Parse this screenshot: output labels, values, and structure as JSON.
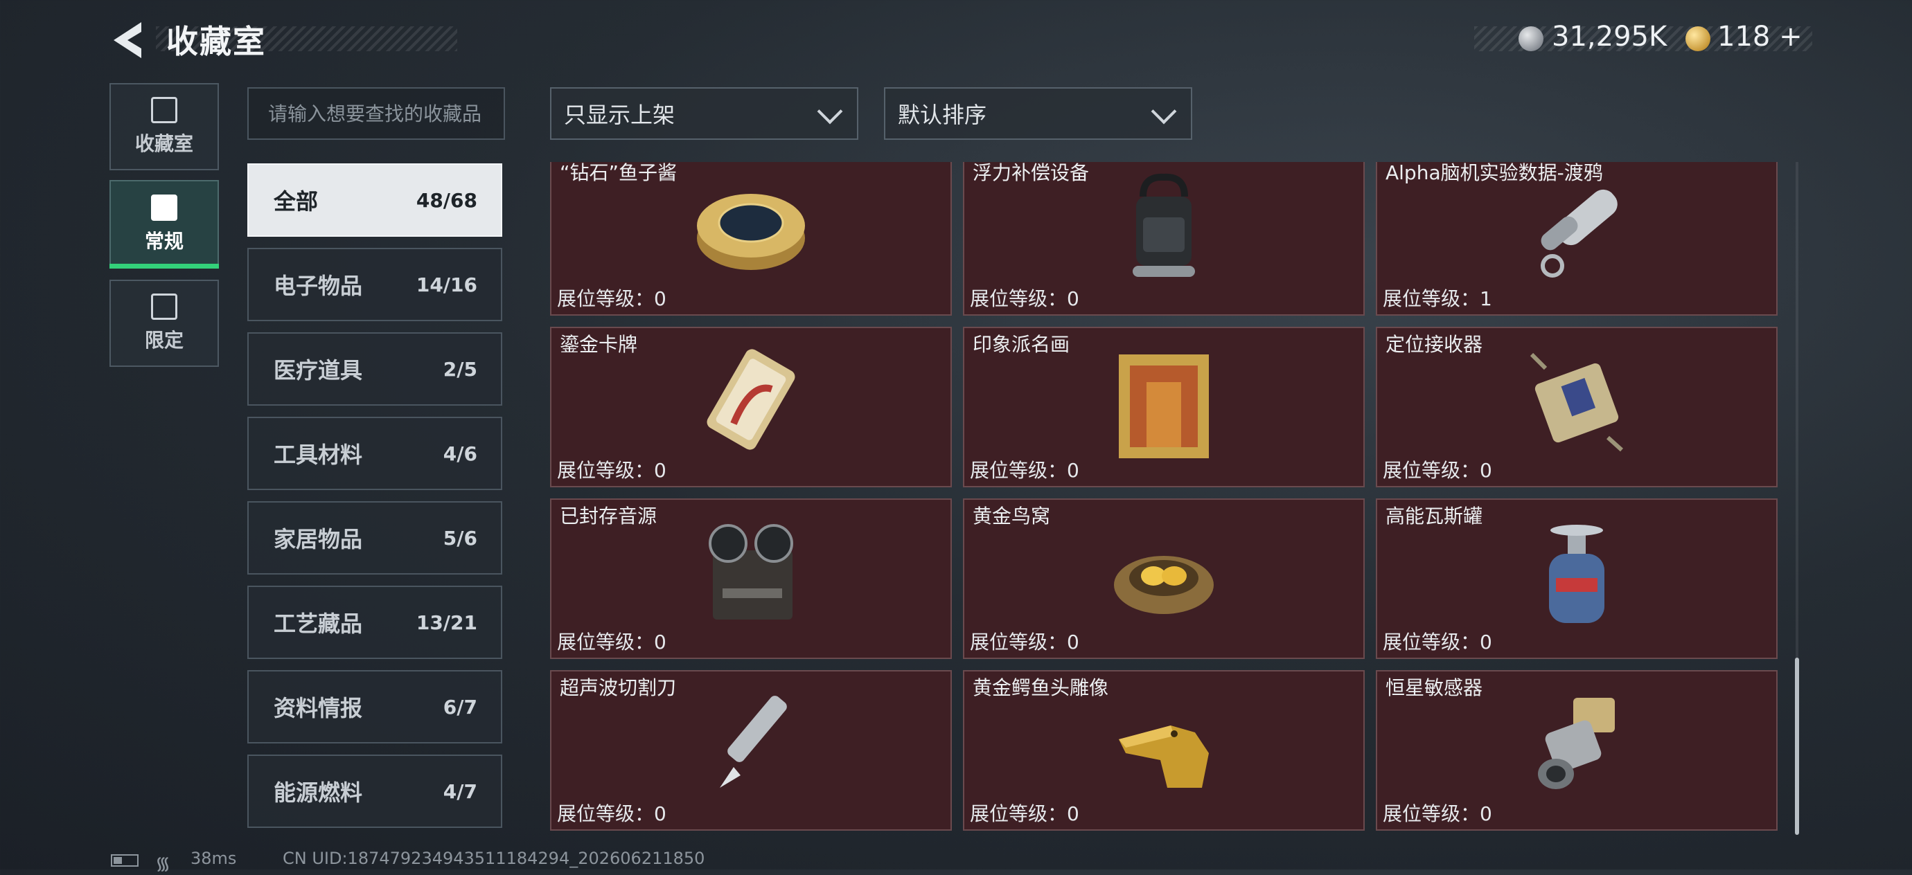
{
  "header": {
    "title": "收藏室",
    "currency": [
      {
        "icon": "silver-coin-icon",
        "value": "31,295K"
      },
      {
        "icon": "gold-triangle-coin-icon",
        "value": "118 +"
      }
    ]
  },
  "nav_tabs": [
    {
      "label": "收藏室",
      "icon": "collection-room-icon",
      "active": false
    },
    {
      "label": "常规",
      "icon": "regular-tab-icon",
      "active": true
    },
    {
      "label": "限定",
      "icon": "limited-tab-icon",
      "active": false
    }
  ],
  "search": {
    "placeholder": "请输入想要查找的收藏品"
  },
  "filters": {
    "listing_filter": "只显示上架",
    "sort": "默认排序"
  },
  "categories": [
    {
      "label": "全部",
      "count": "48/68",
      "active": true
    },
    {
      "label": "电子物品",
      "count": "14/16"
    },
    {
      "label": "医疗道具",
      "count": "2/5"
    },
    {
      "label": "工具材料",
      "count": "4/6"
    },
    {
      "label": "家居物品",
      "count": "5/6"
    },
    {
      "label": "工艺藏品",
      "count": "13/21"
    },
    {
      "label": "资料情报",
      "count": "6/7"
    },
    {
      "label": "能源燃料",
      "count": "4/7"
    }
  ],
  "items": [
    {
      "name": "“钻石”鱼子酱",
      "level": "展位等级：0",
      "icon": "caviar-tin-icon"
    },
    {
      "name": "浮力补偿设备",
      "level": "展位等级：0",
      "icon": "buoyancy-device-icon"
    },
    {
      "name": "Alpha脑机实验数据-渡鸦",
      "level": "展位等级：1",
      "icon": "data-cylinder-icon"
    },
    {
      "name": "鎏金卡牌",
      "level": "展位等级：0",
      "icon": "gilded-card-icon"
    },
    {
      "name": "印象派名画",
      "level": "展位等级：0",
      "icon": "framed-painting-icon"
    },
    {
      "name": "定位接收器",
      "level": "展位等级：0",
      "icon": "locator-receiver-icon"
    },
    {
      "name": "已封存音源",
      "level": "展位等级：0",
      "icon": "reel-tape-recorder-icon"
    },
    {
      "name": "黄金鸟窝",
      "level": "展位等级：0",
      "icon": "golden-nest-icon"
    },
    {
      "name": "高能瓦斯罐",
      "level": "展位等级：0",
      "icon": "gas-canister-icon"
    },
    {
      "name": "超声波切割刀",
      "level": "展位等级：0",
      "icon": "ultrasonic-knife-icon"
    },
    {
      "name": "黄金鳄鱼头雕像",
      "level": "展位等级：0",
      "icon": "golden-crocodile-statue-icon"
    },
    {
      "name": "恒星敏感器",
      "level": "展位等级：0",
      "icon": "star-sensor-icon"
    }
  ],
  "status_bar": {
    "ping": "38ms",
    "uid": "CN UID:187479234943511184294_202606211850"
  },
  "colors": {
    "card_bg": "#3e1f24",
    "active_tab_accent": "#33d17a",
    "active_category_bg": "#e6e9ec"
  }
}
